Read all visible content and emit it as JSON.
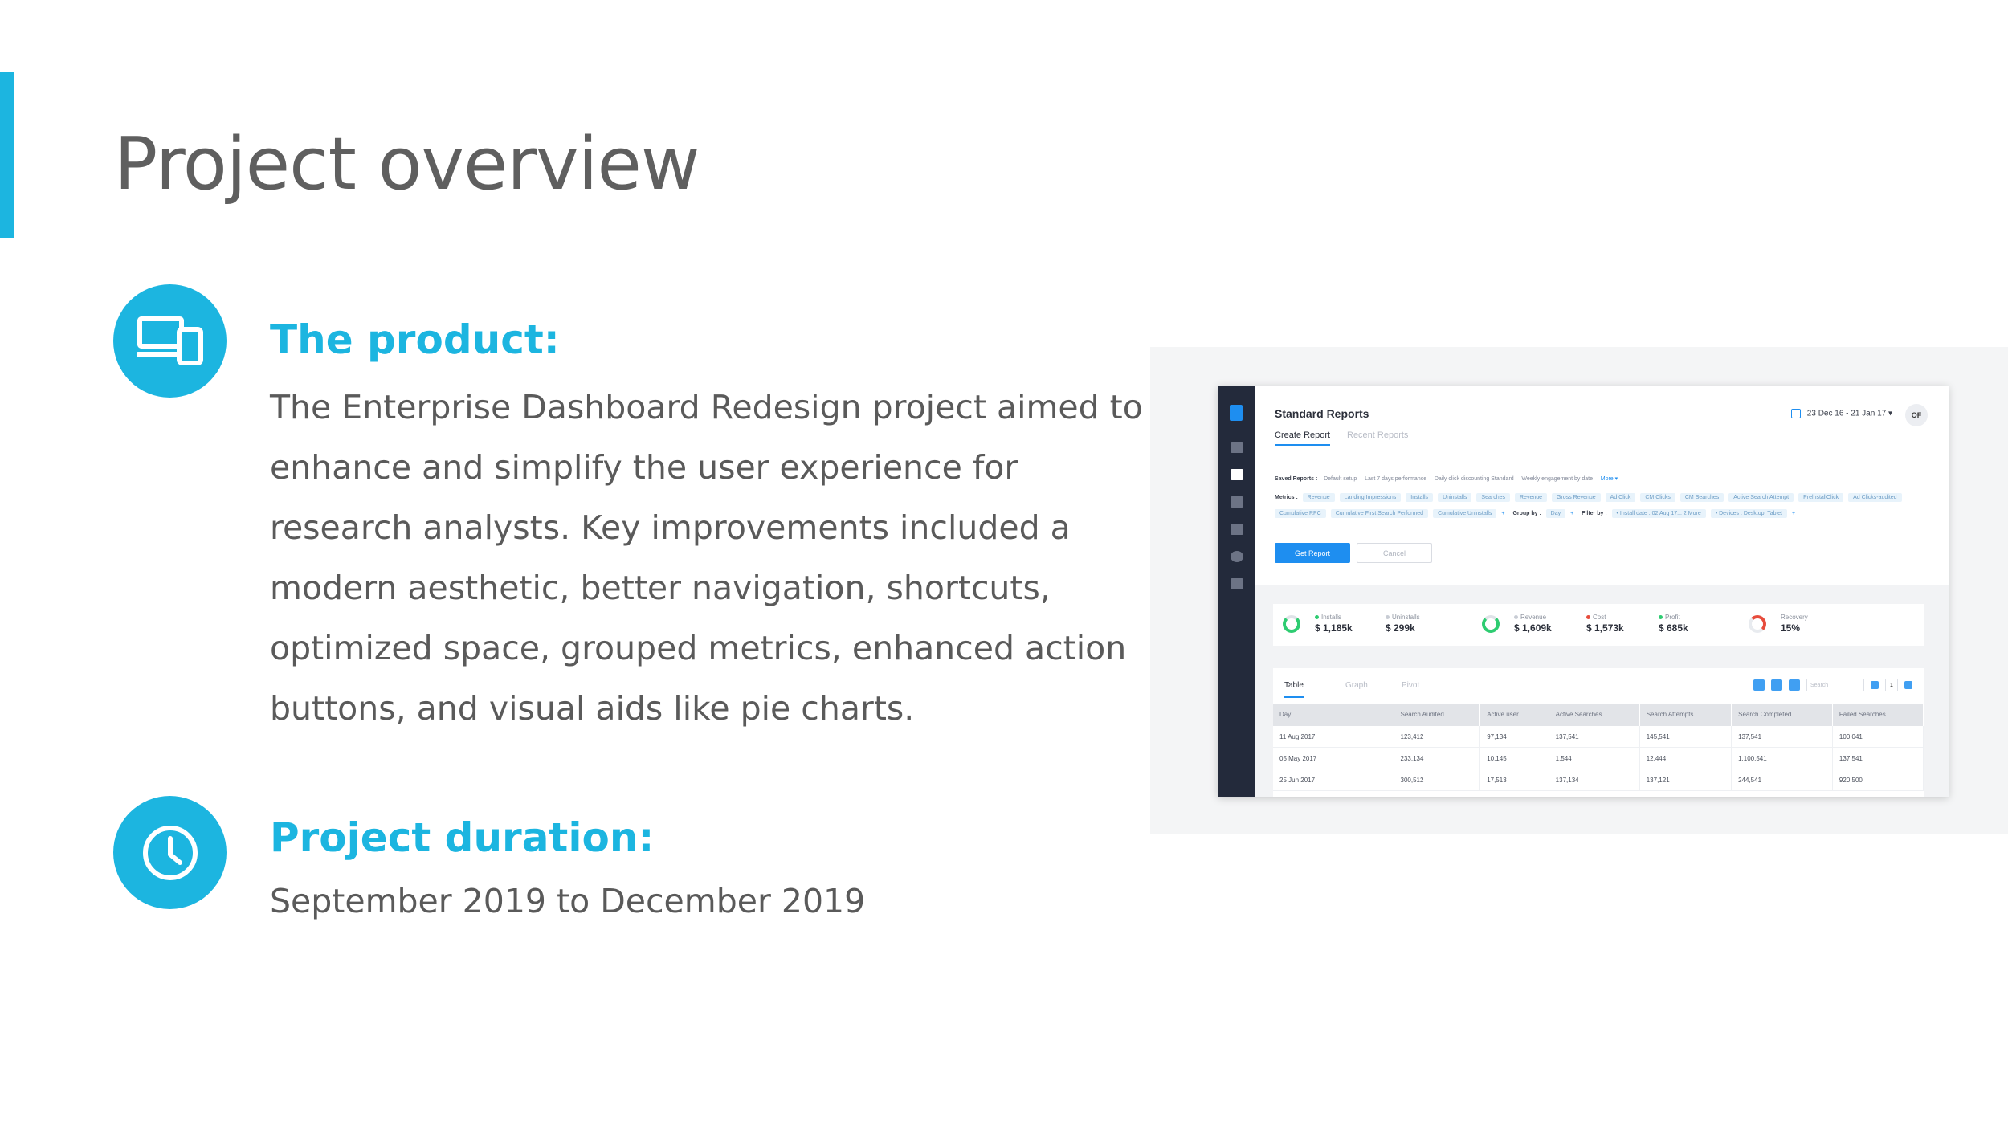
{
  "title": "Project overview",
  "product": {
    "heading": "The product:",
    "icon": "devices-icon",
    "lines": [
      "The Enterprise Dashboard Redesign project aimed to",
      "enhance and simplify the user experience for",
      "research analysts. Key improvements included a",
      "modern aesthetic, better navigation, shortcuts,",
      "optimized space, grouped metrics, enhanced action",
      "buttons, and visual aids like pie charts."
    ]
  },
  "duration": {
    "heading": "Project duration:",
    "icon": "clock-icon",
    "text": "September 2019 to December 2019"
  },
  "colors": {
    "accent": "#1cb5e0",
    "text": "#5a5a5a",
    "dashboard_blue": "#1e8ef0",
    "sidebar": "#232a3b"
  },
  "dashboard": {
    "title": "Standard Reports",
    "tabs": [
      "Create Report",
      "Recent Reports"
    ],
    "date_range": "23 Dec 16 - 21 Jan 17 ▾",
    "avatar": "OF",
    "saved_reports_label": "Saved Reports :",
    "saved_reports": [
      "Default setup",
      "Last 7 days performance",
      "Daily click discounting Standard",
      "Weekly engagement by date"
    ],
    "more": "More ▾",
    "metrics_label": "Metrics :",
    "metrics_row1": [
      "Revenue",
      "Landing Impressions",
      "Installs",
      "Uninstalls",
      "Searches",
      "Revenue",
      "Gross Revenue",
      "Ad Click",
      "CM Clicks",
      "CM Searches",
      "Active Search Attempt",
      "PrelnstallClick",
      "Ad Clicks-audited"
    ],
    "metrics_row2": [
      "Cumulative RPC",
      "Cumulative First Search Performed",
      "Cumulative Uninstalls"
    ],
    "plus": "+",
    "group_by_label": "Group by :",
    "group_by": "Day",
    "filter_by_label": "Filter by :",
    "filter_install": "• Install date : 02 Aug 17... 2 More",
    "filter_devices": "• Devices : Desktop, Tablet",
    "get_report": "Get Report",
    "cancel": "Cancel",
    "kpis": [
      {
        "label": "Installs",
        "value": "$ 1,185k"
      },
      {
        "label": "Uninstalls",
        "value": "$ 299k"
      },
      {
        "label": "Revenue",
        "value": "$ 1,609k"
      },
      {
        "label": "Cost",
        "value": "$ 1,573k"
      },
      {
        "label": "Profit",
        "value": "$ 685k"
      },
      {
        "label": "Recovery",
        "value": "15%"
      }
    ],
    "view_tabs": [
      "Table",
      "Graph",
      "Pivot"
    ],
    "search_placeholder": "Search",
    "page": "1",
    "table": {
      "headers": [
        "Day",
        "Search Audited",
        "Active user",
        "Active Searches",
        "Search Attempts",
        "Search Completed",
        "Failed Searches"
      ],
      "rows": [
        [
          "11 Aug 2017",
          "123,412",
          "97,134",
          "137,541",
          "145,541",
          "137,541",
          "100,041"
        ],
        [
          "05 May 2017",
          "233,134",
          "10,145",
          "1,544",
          "12,444",
          "1,100,541",
          "137,541"
        ],
        [
          "25 Jun 2017",
          "300,512",
          "17,513",
          "137,134",
          "137,121",
          "244,541",
          "920,500"
        ]
      ]
    }
  }
}
